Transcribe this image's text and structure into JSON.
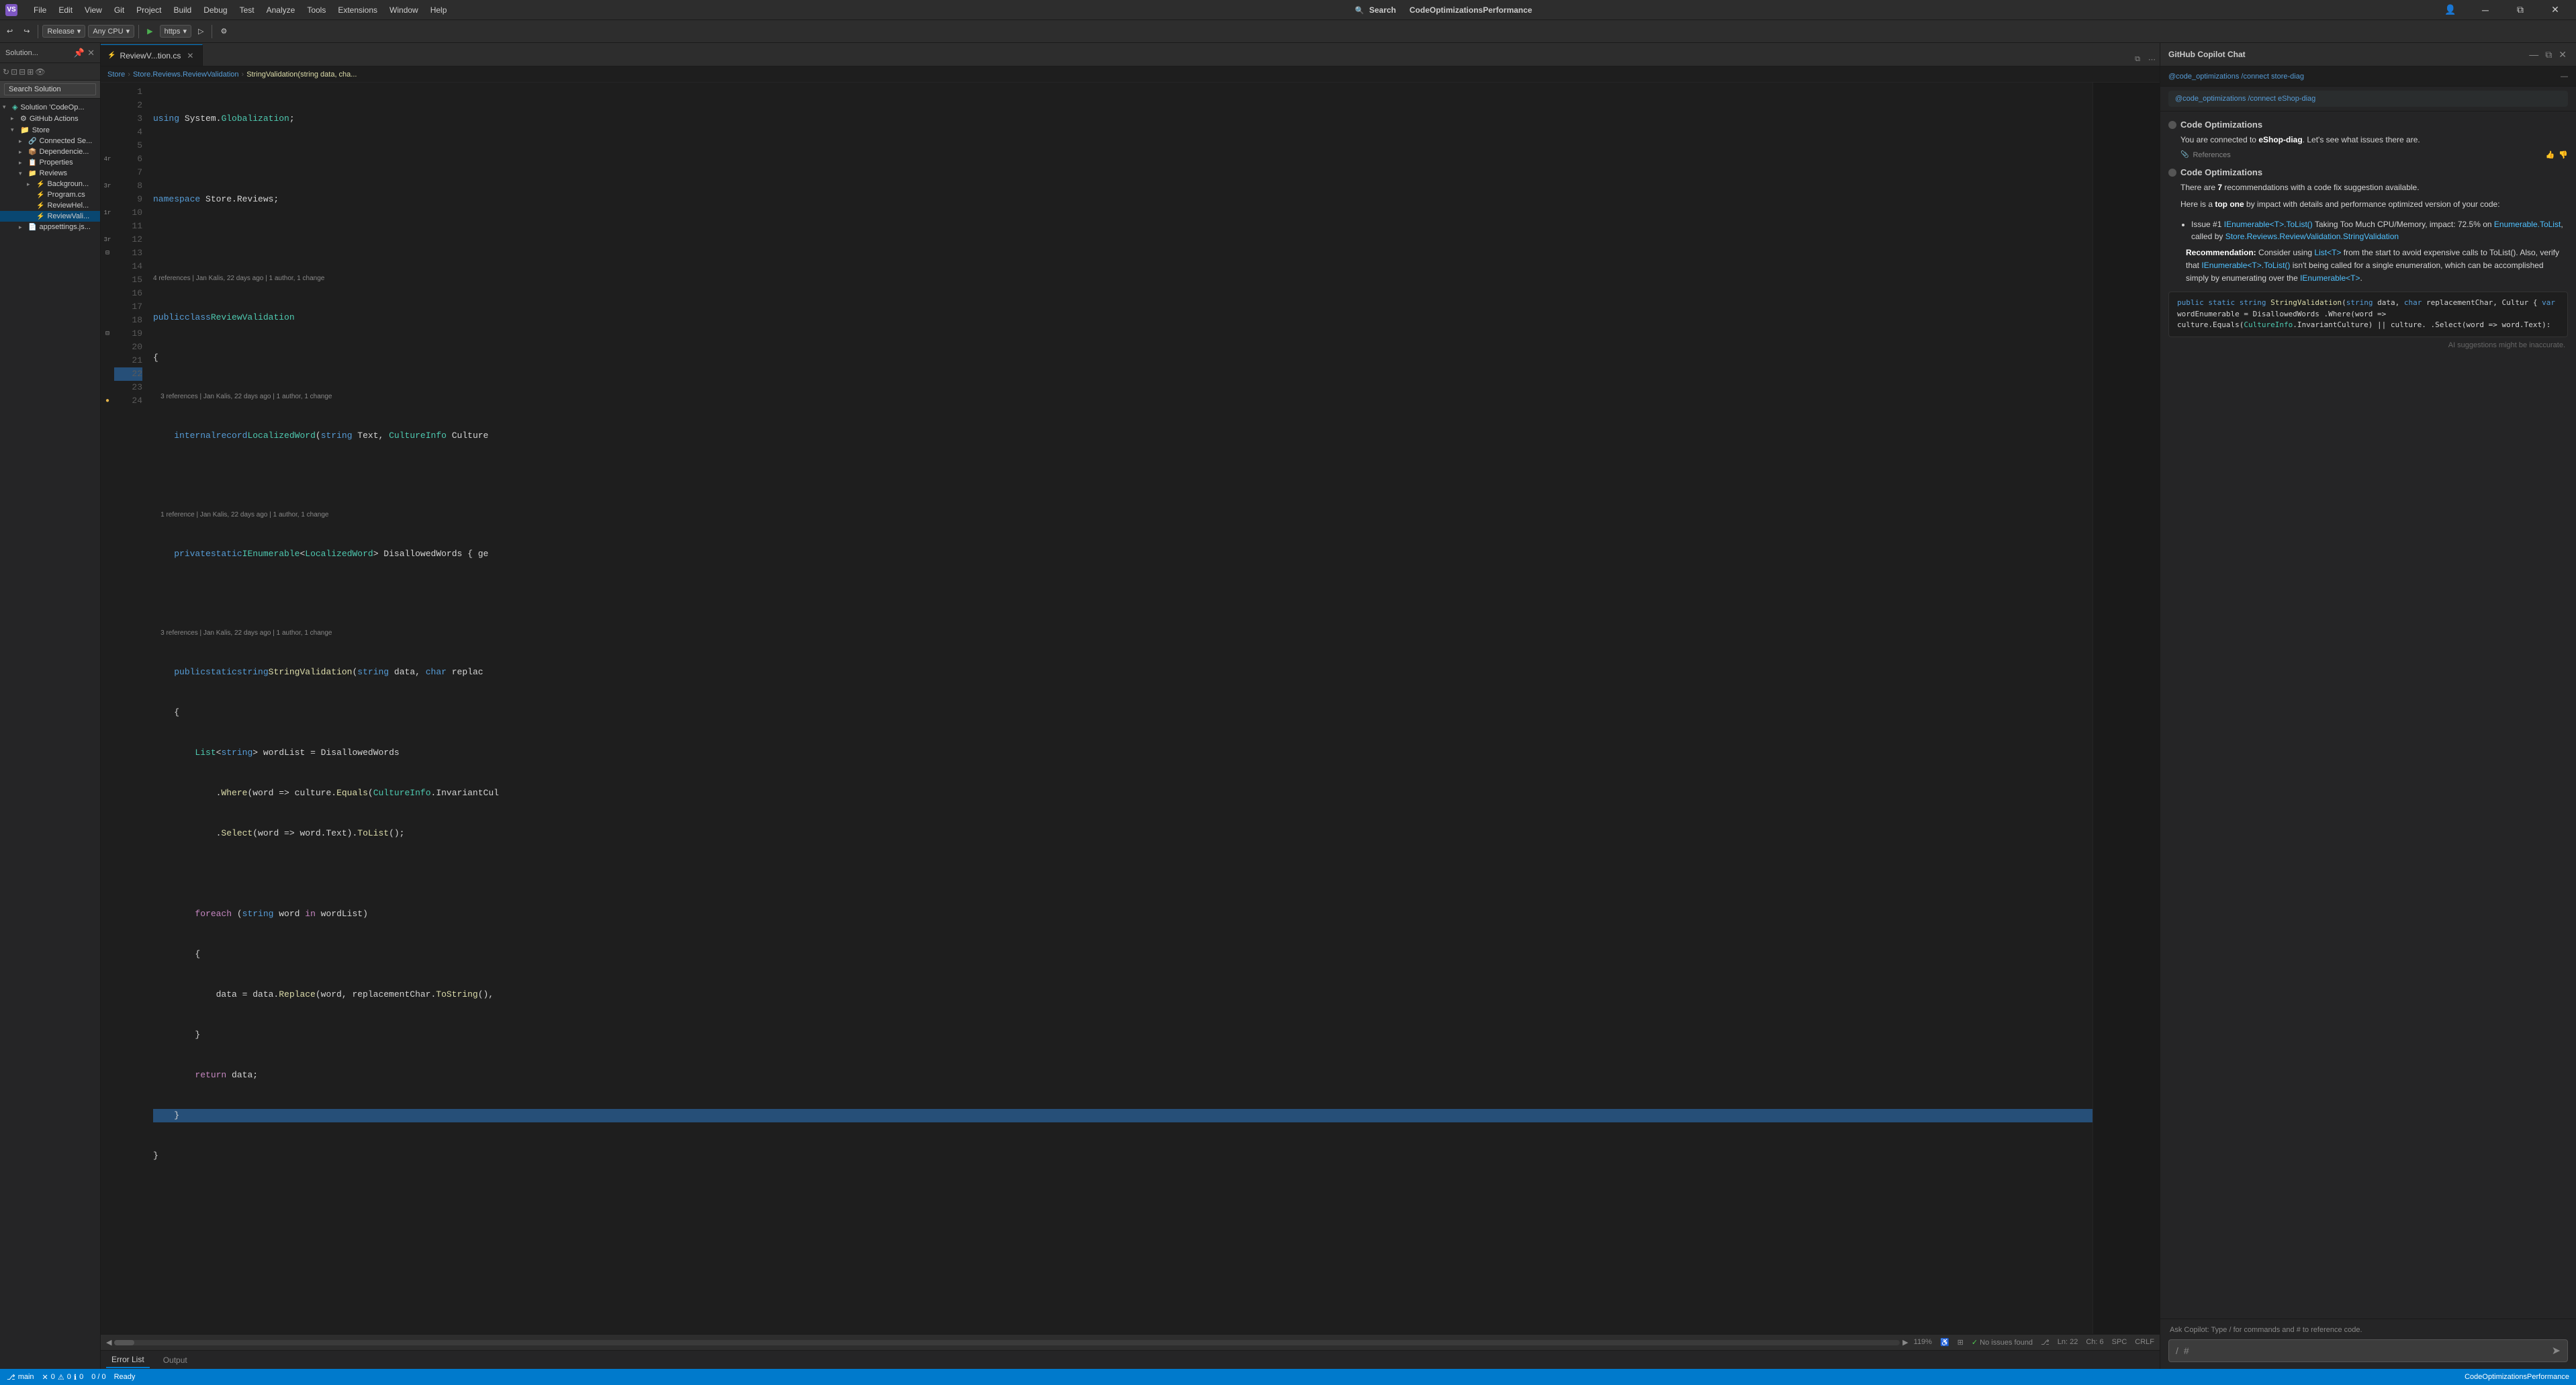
{
  "titleBar": {
    "logo": "VS",
    "menuItems": [
      "File",
      "Edit",
      "View",
      "Git",
      "Project",
      "Build",
      "Debug",
      "Test",
      "Analyze",
      "Tools",
      "Extensions",
      "Window",
      "Help"
    ],
    "searchLabel": "Search",
    "title": "CodeOptimizationsPerformance",
    "windowControls": [
      "minimize",
      "restore",
      "close"
    ]
  },
  "toolbar": {
    "configuration": "Release",
    "platform": "Any CPU",
    "runTarget": "https",
    "undoLabel": "Undo",
    "redoLabel": "Redo"
  },
  "sidebar": {
    "title": "Solution...",
    "searchPlaceholder": "Search Solution",
    "treeItems": [
      {
        "label": "Solution 'CodeOp...",
        "indent": 0,
        "expanded": true,
        "icon": "📁",
        "type": "solution"
      },
      {
        "label": "GitHub Actions",
        "indent": 1,
        "expanded": false,
        "icon": "⚙",
        "type": "folder"
      },
      {
        "label": "Store",
        "indent": 1,
        "expanded": true,
        "icon": "📁",
        "type": "project"
      },
      {
        "label": "Connected Se...",
        "indent": 2,
        "expanded": false,
        "icon": "🔗",
        "type": "folder"
      },
      {
        "label": "Dependencie...",
        "indent": 2,
        "expanded": false,
        "icon": "📦",
        "type": "folder"
      },
      {
        "label": "Properties",
        "indent": 2,
        "expanded": false,
        "icon": "📋",
        "type": "folder"
      },
      {
        "label": "Reviews",
        "indent": 2,
        "expanded": true,
        "icon": "📁",
        "type": "folder"
      },
      {
        "label": "Backgroun...",
        "indent": 3,
        "expanded": false,
        "icon": "⚡",
        "type": "cs"
      },
      {
        "label": "Program.cs",
        "indent": 3,
        "expanded": false,
        "icon": "⚡",
        "type": "cs"
      },
      {
        "label": "ReviewHel...",
        "indent": 3,
        "expanded": false,
        "icon": "⚡",
        "type": "cs"
      },
      {
        "label": "ReviewVali...",
        "indent": 3,
        "expanded": false,
        "icon": "⚡",
        "type": "cs",
        "selected": true
      },
      {
        "label": "appsettings.js...",
        "indent": 2,
        "expanded": false,
        "icon": "📄",
        "type": "json"
      }
    ]
  },
  "editor": {
    "tabs": [
      {
        "label": "ReviewV...tion.cs",
        "active": true,
        "modified": false
      },
      {
        "label": "×",
        "isClose": true
      }
    ],
    "breadcrumb": [
      "Store",
      "Store.Reviews.ReviewValidation",
      "StringValidation(string data, cha..."
    ],
    "fileName": "ReviewValidation.cs",
    "lines": [
      {
        "num": 1,
        "text": "using System.Globalization;",
        "tokens": [
          {
            "t": "kw",
            "v": "using"
          },
          {
            "t": "",
            "v": " System."
          },
          {
            "t": "ns",
            "v": "Globalization"
          },
          {
            "t": "",
            "v": ";"
          }
        ]
      },
      {
        "num": 2,
        "text": "",
        "tokens": []
      },
      {
        "num": 3,
        "text": "namespace Store.Reviews;",
        "tokens": [
          {
            "t": "kw",
            "v": "namespace"
          },
          {
            "t": "",
            "v": " Store.Reviews;"
          }
        ]
      },
      {
        "num": 4,
        "text": "",
        "tokens": []
      },
      {
        "num": 5,
        "text": "public class ReviewValidation",
        "ref": "4 references | Jan Kalis, 22 days ago | 1 author, 1 change",
        "tokens": [
          {
            "t": "kw",
            "v": "public"
          },
          {
            "t": "",
            "v": " "
          },
          {
            "t": "kw",
            "v": "class"
          },
          {
            "t": "",
            "v": " "
          },
          {
            "t": "type",
            "v": "ReviewValidation"
          }
        ]
      },
      {
        "num": 6,
        "text": "{",
        "tokens": [
          {
            "t": "",
            "v": "{"
          }
        ]
      },
      {
        "num": 7,
        "text": "    internal record LocalizedWord(string Text, CultureInfo Culture",
        "ref": "3 references | Jan Kalis, 22 days ago | 1 author, 1 change",
        "tokens": [
          {
            "t": "kw",
            "v": "    internal"
          },
          {
            "t": "",
            "v": " "
          },
          {
            "t": "kw",
            "v": "record"
          },
          {
            "t": "",
            "v": " "
          },
          {
            "t": "type",
            "v": "LocalizedWord"
          },
          {
            "t": "",
            "v": "("
          },
          {
            "t": "kw",
            "v": "string"
          },
          {
            "t": "",
            "v": " Text, "
          },
          {
            "t": "type",
            "v": "CultureInfo"
          },
          {
            "t": "",
            "v": " Culture"
          }
        ]
      },
      {
        "num": 8,
        "text": "",
        "tokens": []
      },
      {
        "num": 9,
        "text": "    private static IEnumerable<LocalizedWord> DisallowedWords { ge",
        "ref": "1 reference | Jan Kalis, 22 days ago | 1 author, 1 change",
        "tokens": [
          {
            "t": "kw",
            "v": "    private"
          },
          {
            "t": "",
            "v": " "
          },
          {
            "t": "kw",
            "v": "static"
          },
          {
            "t": "",
            "v": " "
          },
          {
            "t": "type",
            "v": "IEnumerable"
          },
          {
            "t": "",
            "v": "<"
          },
          {
            "t": "type",
            "v": "LocalizedWord"
          },
          {
            "t": "",
            "v": ""
          },
          {
            "t": "",
            "v": "> DisallowedWords { ge"
          }
        ]
      },
      {
        "num": 10,
        "text": "",
        "tokens": []
      },
      {
        "num": 11,
        "text": "    public static string StringValidation(string data, char replac",
        "ref": "3 references | Jan Kalis, 22 days ago | 1 author, 1 change",
        "tokens": [
          {
            "t": "kw",
            "v": "    public"
          },
          {
            "t": "",
            "v": " "
          },
          {
            "t": "kw",
            "v": "static"
          },
          {
            "t": "",
            "v": " "
          },
          {
            "t": "kw",
            "v": "string"
          },
          {
            "t": "",
            "v": " "
          },
          {
            "t": "method",
            "v": "StringValidation"
          },
          {
            "t": "",
            "v": "("
          },
          {
            "t": "kw",
            "v": "string"
          },
          {
            "t": "",
            "v": " data, "
          },
          {
            "t": "kw",
            "v": "char"
          },
          {
            "t": "",
            "v": " replac"
          }
        ]
      },
      {
        "num": 12,
        "text": "    {",
        "tokens": [
          {
            "t": "",
            "v": "    {"
          }
        ]
      },
      {
        "num": 13,
        "text": "        List<string> wordList = DisallowedWords",
        "tokens": [
          {
            "t": "",
            "v": "        "
          },
          {
            "t": "type",
            "v": "List"
          },
          {
            "t": "",
            "v": "<"
          },
          {
            "t": "kw",
            "v": "string"
          },
          {
            "t": "",
            "v": ""
          },
          {
            "t": "",
            "v": "> wordList = DisallowedWords"
          }
        ]
      },
      {
        "num": 14,
        "text": "            .Where(word => culture.Equals(CultureInfo.InvariantCul",
        "tokens": [
          {
            "t": "",
            "v": "            ."
          },
          {
            "t": "method",
            "v": "Where"
          },
          {
            "t": "",
            "v": "(word => culture."
          },
          {
            "t": "method",
            "v": "Equals"
          },
          {
            "t": "",
            "v": "("
          },
          {
            "t": "type",
            "v": "CultureInfo"
          },
          {
            "t": "",
            "v": ".InvariantCul"
          }
        ]
      },
      {
        "num": 15,
        "text": "            .Select(word => word.Text).ToList();",
        "tokens": [
          {
            "t": "",
            "v": "            ."
          },
          {
            "t": "method",
            "v": "Select"
          },
          {
            "t": "",
            "v": "(word => word.Text)."
          },
          {
            "t": "method",
            "v": "ToList"
          },
          {
            "t": "",
            "v": "();"
          }
        ]
      },
      {
        "num": 16,
        "text": "",
        "tokens": []
      },
      {
        "num": 17,
        "text": "        foreach (string word in wordList)",
        "tokens": [
          {
            "t": "kw2",
            "v": "        foreach"
          },
          {
            "t": "",
            "v": " ("
          },
          {
            "t": "kw",
            "v": "string"
          },
          {
            "t": "",
            "v": " word "
          },
          {
            "t": "kw2",
            "v": "in"
          },
          {
            "t": "",
            "v": " wordList)"
          }
        ]
      },
      {
        "num": 18,
        "text": "        {",
        "tokens": [
          {
            "t": "",
            "v": "        {"
          }
        ]
      },
      {
        "num": 19,
        "text": "            data = data.Replace(word, replacementChar.ToString(),",
        "tokens": [
          {
            "t": "",
            "v": "            data = data."
          },
          {
            "t": "method",
            "v": "Replace"
          },
          {
            "t": "",
            "v": "(word, replacementChar."
          },
          {
            "t": "method",
            "v": "ToString"
          },
          {
            "t": "",
            "v": "(),"
          }
        ]
      },
      {
        "num": 20,
        "text": "        }",
        "tokens": [
          {
            "t": "",
            "v": "        }"
          }
        ]
      },
      {
        "num": 21,
        "text": "        return data;",
        "tokens": [
          {
            "t": "",
            "v": "        "
          },
          {
            "t": "kw2",
            "v": "return"
          },
          {
            "t": "",
            "v": " data;"
          }
        ]
      },
      {
        "num": 22,
        "text": "    }",
        "highlight": true,
        "tokens": [
          {
            "t": "",
            "v": "    }"
          }
        ]
      },
      {
        "num": 23,
        "text": "}",
        "tokens": [
          {
            "t": "",
            "v": "}"
          }
        ]
      },
      {
        "num": 24,
        "text": "",
        "tokens": []
      }
    ],
    "statusInfo": {
      "zoom": "119%",
      "issues": "No issues found",
      "line": "Ln: 22",
      "col": "Ch: 6",
      "encoding": "SPC",
      "lineEnding": "CRLF"
    },
    "scrollbarLabel": ""
  },
  "copilot": {
    "title": "GitHub Copilot Chat",
    "contextLabel": "@code_optimizations /connect store-diag",
    "suggestion": "@code_optimizations /connect eShop-diag",
    "messages": [
      {
        "type": "bot",
        "title": "Code Optimizations",
        "body": "You are connected to eShop-diag. Let's see what issues there are.",
        "hasReferences": true,
        "referencesLabel": "References"
      },
      {
        "type": "bot",
        "title": "Code Optimizations",
        "body": "There are 7 recommendations with a code fix suggestion available.",
        "body2": "Here is a top one by impact with details and performance optimized version of your code:",
        "issue": {
          "number": "1",
          "link1": "IEnumerable<T>.ToList()",
          "description": " Taking Too Much CPU/Memory, impact: 72.5% on ",
          "link2": "Enumerable.ToList",
          "description2": ", called by ",
          "link3": "Store.Reviews.ReviewValidation.StringValidation",
          "recommendation": "Recommendation: Consider using ",
          "link4": "List<T>",
          "recommendation2": " from the start to avoid expensive calls to ToList(). Also, verify that ",
          "link5": "IEnumerable<T>.ToList()",
          "recommendation3": " isn't being called for a single enumeration, which can be accomplished simply by enumerating over the ",
          "link6": "IEnumerable<T>",
          "recommendation4": "."
        },
        "codeBlock": "public static string StringValidation(string data, char replacementChar, Cultur\n{\n    var wordEnumerable = DisallowedWords\n        .Where(word => culture.Equals(CultureInfo.InvariantCulture) || culture.\n        .Select(word => word.Text):"
      }
    ],
    "disclaimer": "AI suggestions might be inaccurate.",
    "inputPlaceholder": "Ask Copilot: Type / for commands and # to reference code.",
    "inputSlash": "/",
    "inputHash": "#"
  },
  "statusBar": {
    "ready": "Ready",
    "gitBranch": "main",
    "errors": "0",
    "warnings": "0",
    "info": "0",
    "cursorInfo": "0 / 0",
    "appName": "CodeOptimizationsPerformance"
  },
  "bottomTabs": {
    "tabs": [
      "Error List",
      "Output"
    ]
  }
}
